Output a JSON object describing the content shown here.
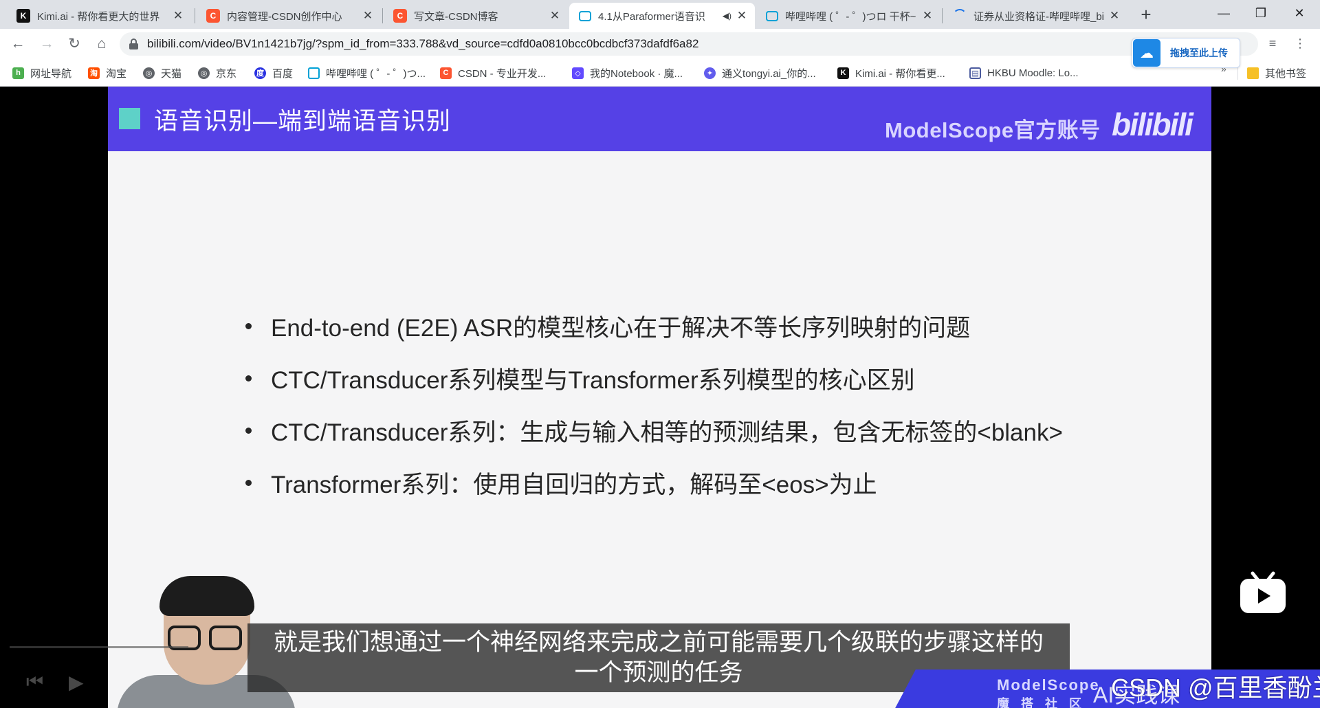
{
  "browser": {
    "tabs": [
      {
        "title": "Kimi.ai - 帮你看更大的世界",
        "icon": "kimi-icon",
        "active": false
      },
      {
        "title": "内容管理-CSDN创作中心",
        "icon": "csdn-icon",
        "active": false
      },
      {
        "title": "写文章-CSDN博客",
        "icon": "csdn-icon",
        "active": false
      },
      {
        "title": "4.1从Paraformer语音识",
        "icon": "bilibili-icon",
        "active": true
      },
      {
        "title": "哔哩哔哩 ( ゜- ゜)つロ 干杯~",
        "icon": "bilibili-icon",
        "active": false
      },
      {
        "title": "证券从业资格证-哔哩哔哩_bi",
        "icon": "loading-icon",
        "active": false
      }
    ],
    "new_tab": "+",
    "window_controls": {
      "minimize": "—",
      "restore": "❐",
      "close": "✕"
    },
    "url": "bilibili.com/video/BV1n1421b7jg/?spm_id_from=333.788&vd_source=cdfd0a0810bcc0bcdbcf373dafdf6a82",
    "upload_button": "拖拽至此上传",
    "bookmarks": [
      {
        "label": "网址导航",
        "icon": "hao-icon"
      },
      {
        "label": "淘宝",
        "icon": "taobao-icon"
      },
      {
        "label": "天猫",
        "icon": "globe-icon"
      },
      {
        "label": "京东",
        "icon": "globe-icon"
      },
      {
        "label": "百度",
        "icon": "baidu-icon"
      },
      {
        "label": "哔哩哔哩 ( ゜- ゜)つ...",
        "icon": "bilibili-icon"
      },
      {
        "label": "CSDN - 专业开发...",
        "icon": "csdn-icon"
      },
      {
        "label": "我的Notebook · 魔...",
        "icon": "modelscope-icon"
      },
      {
        "label": "通义tongyi.ai_你的...",
        "icon": "tongyi-icon"
      },
      {
        "label": "Kimi.ai - 帮你看更...",
        "icon": "kimi-icon"
      },
      {
        "label": "HKBU Moodle: Lo...",
        "icon": "moodle-icon"
      }
    ],
    "bookmarks_overflow": "»",
    "other_bookmarks": "其他书签"
  },
  "slide": {
    "title": "语音识别—端到端语音识别",
    "brand": "ModelScope官方账号",
    "brand_logo": "bilibili",
    "bullets": [
      "End-to-end (E2E) ASR的模型核心在于解决不等长序列映射的问题",
      "CTC/Transducer系列模型与Transformer系列模型的核心区别",
      "CTC/Transducer系列：生成与输入相等的预测结果，包含无标签的<blank>",
      "Transformer系列：使用自回归的方式，解码至<eos>为止"
    ]
  },
  "video": {
    "subtitle_line1": "就是我们想通过一个神经网络来完成之前可能需要几个级联的步骤这样的",
    "subtitle_line2": "一个预测的任务",
    "banner_text": "ModelScope",
    "banner_sub": "魔 搭 社 区",
    "banner_course": "AI实践课",
    "watermark": "CSDN @百里香酚兰"
  },
  "colors": {
    "slide_header": "#5541e6",
    "accent_square": "#5ed1c8",
    "bilibili_blue": "#00a1d6",
    "csdn_red": "#fc5531"
  }
}
